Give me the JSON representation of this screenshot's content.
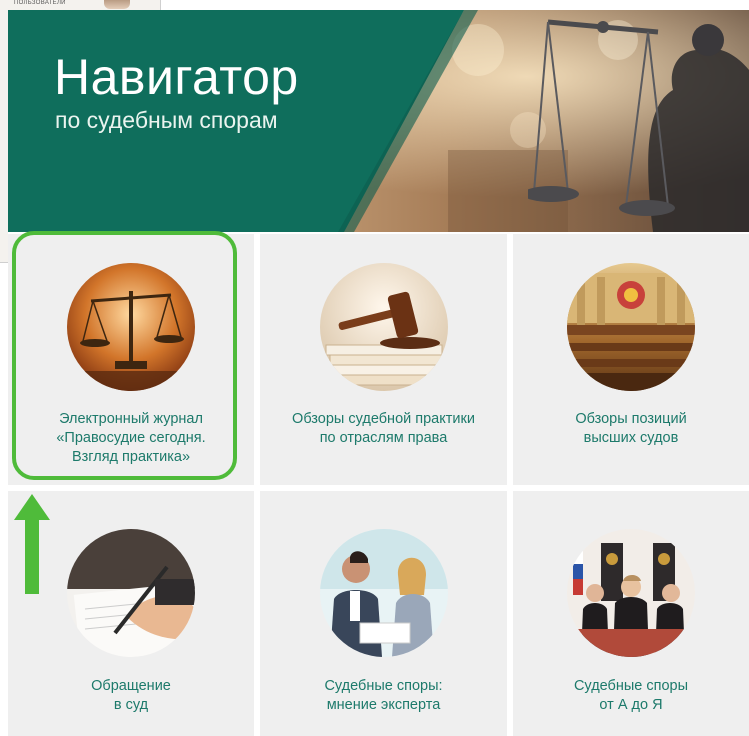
{
  "background_window": {
    "label": "ПОЛЬЗОВАТЕЛИ"
  },
  "banner": {
    "title": "Навигатор",
    "subtitle": "по судебным спорам"
  },
  "tiles": [
    {
      "label": "Электронный журнал\n«Правосудие сегодня.\nВзгляд практика»",
      "image": "scales-of-justice"
    },
    {
      "label": "Обзоры судебной практики\nпо отраслям права",
      "image": "gavel-and-papers"
    },
    {
      "label": "Обзоры позиций\nвысших судов",
      "image": "courtroom-hall"
    },
    {
      "label": "Обращение\nв суд",
      "image": "hand-writing-with-pen"
    },
    {
      "label": "Судебные споры:\nмнение эксперта",
      "image": "two-experts-discussing"
    },
    {
      "label": "Судебные споры\nот А до Я",
      "image": "judges-panel"
    }
  ],
  "colors": {
    "brand_green": "#0f6e5c",
    "label_green": "#1d7a6b",
    "tile_bg": "#efefef",
    "highlight": "#4fbb3a"
  }
}
